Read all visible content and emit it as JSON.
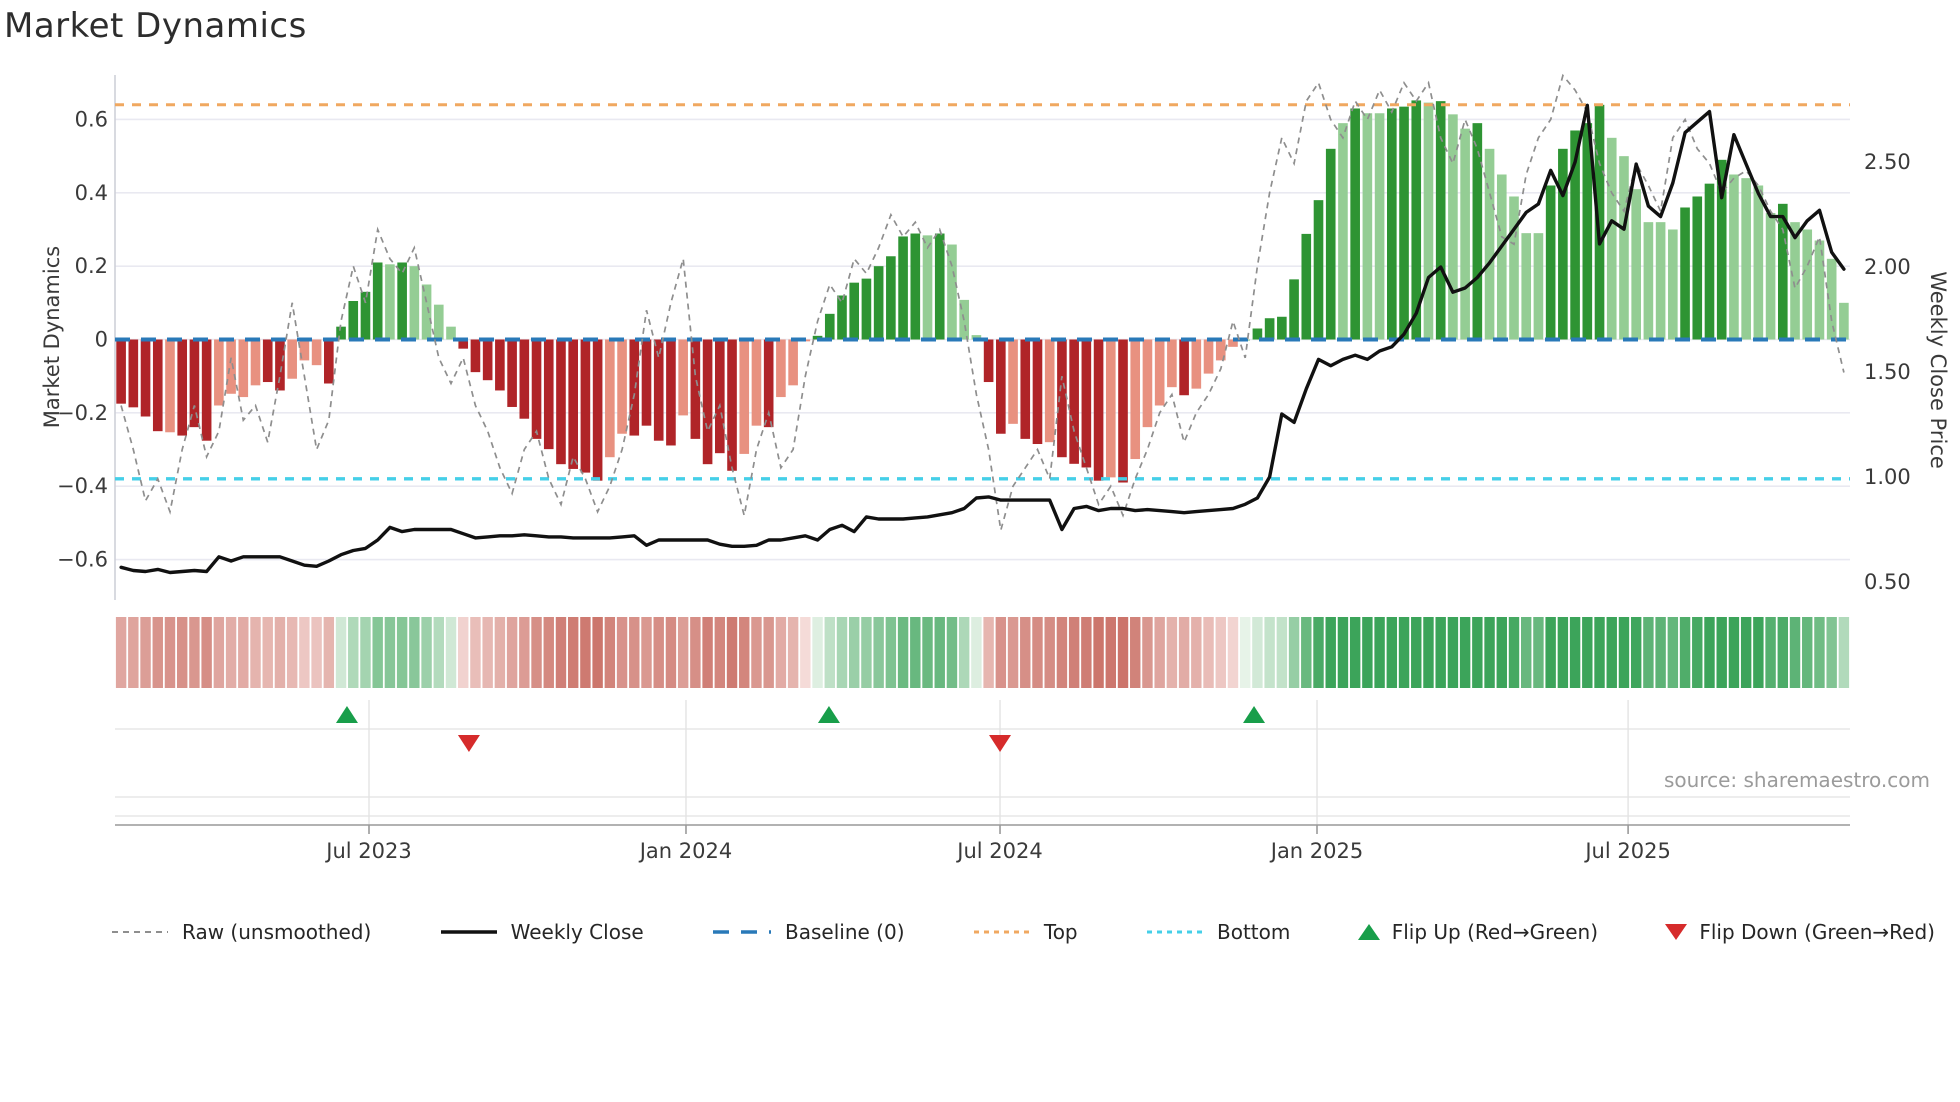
{
  "title": "Market Dynamics",
  "source": "source: sharemaestro.com",
  "left_axis": {
    "label": "Market Dynamics",
    "ticks": [
      "0.6",
      "0.4",
      "0.2",
      "0",
      "−0.2",
      "−0.4",
      "−0.6"
    ],
    "tick_values": [
      0.6,
      0.4,
      0.2,
      0,
      -0.2,
      -0.4,
      -0.6
    ],
    "range": [
      -0.72,
      0.72
    ]
  },
  "right_axis": {
    "label": "Weekly Close Price",
    "ticks": [
      "2.50",
      "2.00",
      "1.50",
      "1.00",
      "0.50"
    ],
    "tick_values": [
      2.5,
      2.0,
      1.5,
      1.0,
      0.5
    ],
    "range": [
      0.41,
      2.91
    ]
  },
  "x_axis": {
    "ticks": [
      {
        "label": "Jul 2023",
        "frac": 0.1464
      },
      {
        "label": "Jan 2024",
        "frac": 0.3291
      },
      {
        "label": "Jul 2024",
        "frac": 0.5101
      },
      {
        "label": "Jan 2025",
        "frac": 0.6928
      },
      {
        "label": "Jul 2025",
        "frac": 0.8721
      }
    ]
  },
  "legend": {
    "raw": "Raw (unsmoothed)",
    "weekly_close": "Weekly Close",
    "baseline": "Baseline (0)",
    "top": "Top",
    "bottom": "Bottom",
    "flip_up": "Flip Up (Red→Green)",
    "flip_down": "Flip Down (Green→Red)"
  },
  "colors": {
    "dark_red": "#b02428",
    "light_red": "#e89180",
    "dark_green": "#2e9433",
    "light_green": "#94cd94",
    "baseline": "#2979b8",
    "top_line": "#f0a860",
    "bottom_line": "#45cfe8",
    "raw_line": "#8e8e8e",
    "price_line": "#111111",
    "grid": "#e9e9f1",
    "spine": "#cfd0d8",
    "heat_red_max": "#c96e64",
    "heat_red_min": "#f6dedb",
    "heat_green_max": "#3ca45a",
    "heat_green_min": "#e7f3e8",
    "flip_up": "#189e4a",
    "flip_down": "#d62b2b",
    "tick_text": "#3a3a3a"
  },
  "chart_data": {
    "type": "combo",
    "title": "Market Dynamics",
    "ylabel_left": "Market Dynamics",
    "ylabel_right": "Weekly Close Price",
    "frequency": "weekly",
    "n_points": 142,
    "baseline_value": 0,
    "top_threshold": 0.64,
    "bottom_threshold": -0.38,
    "osc": [
      -0.175,
      -0.185,
      -0.21,
      -0.25,
      -0.253,
      -0.262,
      -0.239,
      -0.276,
      -0.18,
      -0.148,
      -0.157,
      -0.125,
      -0.116,
      -0.139,
      -0.107,
      -0.057,
      -0.07,
      -0.12,
      0.035,
      0.105,
      0.13,
      0.21,
      0.205,
      0.21,
      0.2,
      0.15,
      0.095,
      0.035,
      -0.025,
      -0.089,
      -0.111,
      -0.139,
      -0.184,
      -0.216,
      -0.271,
      -0.299,
      -0.34,
      -0.353,
      -0.363,
      -0.385,
      -0.321,
      -0.257,
      -0.262,
      -0.235,
      -0.276,
      -0.289,
      -0.207,
      -0.271,
      -0.34,
      -0.31,
      -0.358,
      -0.312,
      -0.235,
      -0.239,
      -0.157,
      -0.125,
      -0.005,
      0.01,
      0.07,
      0.12,
      0.155,
      0.166,
      0.2,
      0.227,
      0.281,
      0.289,
      0.284,
      0.289,
      0.259,
      0.108,
      0.012,
      -0.116,
      -0.257,
      -0.23,
      -0.271,
      -0.285,
      -0.28,
      -0.321,
      -0.339,
      -0.349,
      -0.385,
      -0.376,
      -0.39,
      -0.326,
      -0.239,
      -0.18,
      -0.13,
      -0.152,
      -0.134,
      -0.093,
      -0.057,
      -0.02,
      0.0,
      0.03,
      0.058,
      0.062,
      0.164,
      0.288,
      0.38,
      0.52,
      0.59,
      0.63,
      0.617,
      0.617,
      0.63,
      0.635,
      0.652,
      0.646,
      0.65,
      0.614,
      0.575,
      0.59,
      0.52,
      0.45,
      0.39,
      0.29,
      0.29,
      0.42,
      0.52,
      0.57,
      0.59,
      0.64,
      0.55,
      0.5,
      0.41,
      0.32,
      0.32,
      0.3,
      0.36,
      0.39,
      0.425,
      0.49,
      0.45,
      0.44,
      0.42,
      0.345,
      0.37,
      0.32,
      0.3,
      0.27,
      0.22,
      0.1
    ],
    "shade": [
      "d",
      "d",
      "d",
      "d",
      "l",
      "d",
      "d",
      "d",
      "l",
      "l",
      "l",
      "l",
      "d",
      "d",
      "l",
      "l",
      "l",
      "d",
      "d",
      "d",
      "d",
      "d",
      "l",
      "d",
      "l",
      "l",
      "l",
      "l",
      "d",
      "d",
      "d",
      "d",
      "d",
      "d",
      "d",
      "d",
      "d",
      "d",
      "d",
      "d",
      "l",
      "l",
      "d",
      "d",
      "d",
      "d",
      "l",
      "d",
      "d",
      "d",
      "d",
      "l",
      "l",
      "d",
      "l",
      "l",
      "l",
      "d",
      "d",
      "d",
      "d",
      "d",
      "d",
      "d",
      "d",
      "d",
      "l",
      "d",
      "l",
      "l",
      "l",
      "d",
      "d",
      "l",
      "d",
      "d",
      "l",
      "d",
      "d",
      "d",
      "d",
      "l",
      "d",
      "l",
      "l",
      "l",
      "l",
      "d",
      "l",
      "l",
      "l",
      "l",
      "l",
      "d",
      "d",
      "d",
      "d",
      "d",
      "d",
      "d",
      "l",
      "d",
      "l",
      "l",
      "d",
      "d",
      "d",
      "l",
      "d",
      "l",
      "l",
      "d",
      "l",
      "l",
      "l",
      "l",
      "l",
      "d",
      "d",
      "d",
      "d",
      "d",
      "l",
      "l",
      "l",
      "l",
      "l",
      "l",
      "d",
      "d",
      "d",
      "d",
      "l",
      "l",
      "l",
      "l",
      "d",
      "l",
      "l",
      "l",
      "l",
      "l"
    ],
    "raw": [
      -0.18,
      -0.3,
      -0.44,
      -0.38,
      -0.47,
      -0.3,
      -0.18,
      -0.32,
      -0.25,
      -0.05,
      -0.22,
      -0.18,
      -0.28,
      -0.1,
      0.1,
      -0.1,
      -0.3,
      -0.22,
      0.05,
      0.2,
      0.1,
      0.3,
      0.22,
      0.18,
      0.25,
      0.1,
      -0.05,
      -0.12,
      -0.05,
      -0.18,
      -0.25,
      -0.35,
      -0.42,
      -0.3,
      -0.25,
      -0.38,
      -0.45,
      -0.32,
      -0.38,
      -0.47,
      -0.4,
      -0.3,
      -0.15,
      0.08,
      -0.05,
      0.1,
      0.22,
      -0.1,
      -0.25,
      -0.18,
      -0.35,
      -0.48,
      -0.3,
      -0.2,
      -0.35,
      -0.3,
      -0.1,
      0.05,
      0.15,
      0.1,
      0.22,
      0.18,
      0.25,
      0.34,
      0.28,
      0.32,
      0.25,
      0.3,
      0.2,
      0.05,
      -0.15,
      -0.3,
      -0.52,
      -0.4,
      -0.35,
      -0.3,
      -0.38,
      -0.1,
      -0.25,
      -0.35,
      -0.45,
      -0.4,
      -0.48,
      -0.38,
      -0.3,
      -0.2,
      -0.15,
      -0.28,
      -0.2,
      -0.15,
      -0.08,
      0.05,
      -0.05,
      0.2,
      0.4,
      0.55,
      0.48,
      0.65,
      0.7,
      0.6,
      0.55,
      0.65,
      0.6,
      0.68,
      0.62,
      0.7,
      0.65,
      0.7,
      0.55,
      0.48,
      0.6,
      0.52,
      0.4,
      0.28,
      0.26,
      0.45,
      0.55,
      0.6,
      0.72,
      0.68,
      0.62,
      0.48,
      0.4,
      0.35,
      0.48,
      0.42,
      0.35,
      0.55,
      0.6,
      0.52,
      0.48,
      0.4,
      0.44,
      0.46,
      0.42,
      0.35,
      0.3,
      0.14,
      0.2,
      0.28,
      0.05,
      -0.09
    ],
    "price": [
      0.57,
      0.555,
      0.55,
      0.56,
      0.545,
      0.55,
      0.555,
      0.55,
      0.62,
      0.6,
      0.62,
      0.62,
      0.62,
      0.62,
      0.6,
      0.58,
      0.575,
      0.6,
      0.63,
      0.65,
      0.66,
      0.7,
      0.76,
      0.74,
      0.75,
      0.75,
      0.75,
      0.75,
      0.73,
      0.71,
      0.715,
      0.72,
      0.72,
      0.725,
      0.72,
      0.715,
      0.715,
      0.71,
      0.71,
      0.71,
      0.71,
      0.715,
      0.72,
      0.675,
      0.7,
      0.7,
      0.7,
      0.7,
      0.7,
      0.68,
      0.67,
      0.67,
      0.675,
      0.7,
      0.7,
      0.71,
      0.72,
      0.7,
      0.75,
      0.77,
      0.74,
      0.81,
      0.8,
      0.8,
      0.8,
      0.805,
      0.81,
      0.82,
      0.83,
      0.85,
      0.9,
      0.905,
      0.89,
      0.89,
      0.89,
      0.89,
      0.89,
      0.75,
      0.85,
      0.86,
      0.84,
      0.85,
      0.85,
      0.84,
      0.845,
      0.84,
      0.835,
      0.83,
      0.835,
      0.84,
      0.845,
      0.85,
      0.87,
      0.9,
      1.0,
      1.3,
      1.26,
      1.42,
      1.56,
      1.53,
      1.56,
      1.58,
      1.56,
      1.6,
      1.62,
      1.68,
      1.78,
      1.95,
      2.0,
      1.88,
      1.9,
      1.95,
      2.02,
      2.1,
      2.18,
      2.26,
      2.3,
      2.46,
      2.34,
      2.5,
      2.77,
      2.11,
      2.22,
      2.18,
      2.49,
      2.29,
      2.24,
      2.4,
      2.64,
      2.69,
      2.74,
      2.33,
      2.63,
      2.49,
      2.35,
      2.24,
      2.24,
      2.14,
      2.22,
      2.27,
      2.07,
      1.99
    ],
    "flip_up_fracs": [
      0.1337,
      0.4115,
      0.6565
    ],
    "flip_down_fracs": [
      0.204,
      0.5101
    ],
    "legend_entries": [
      "Raw (unsmoothed)",
      "Weekly Close",
      "Baseline (0)",
      "Top",
      "Bottom",
      "Flip Up (Red→Green)",
      "Flip Down (Green→Red)"
    ]
  }
}
